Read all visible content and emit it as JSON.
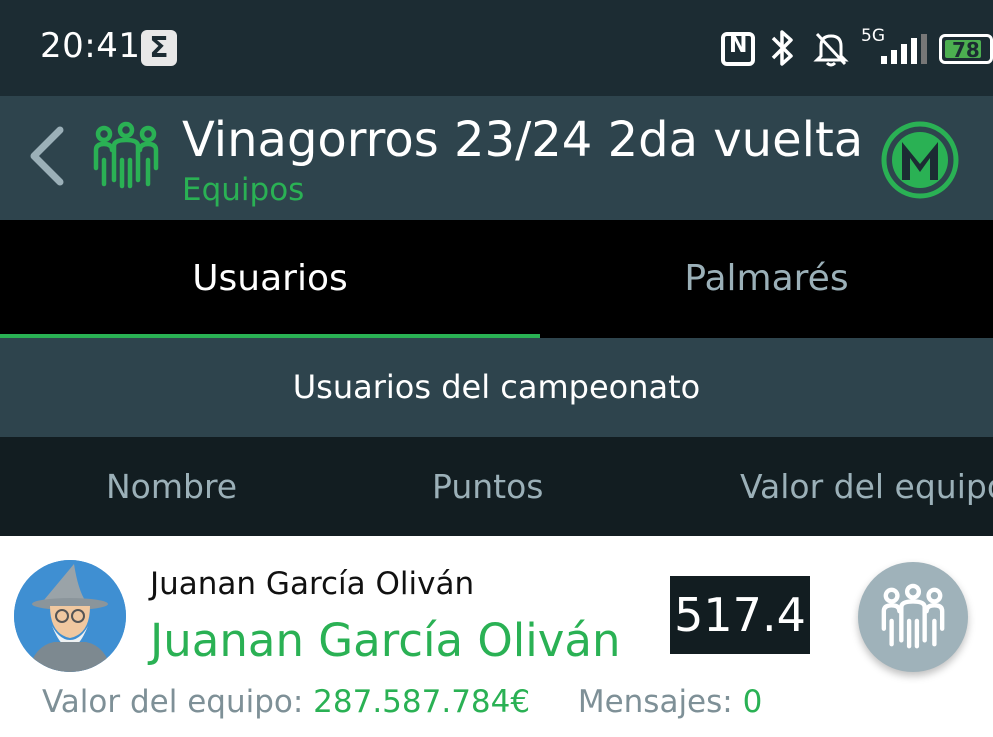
{
  "status_bar": {
    "time": "20:41",
    "notification_icon": "sigma-icon",
    "network_label": "5G",
    "battery_level": "78",
    "battery_color": "#4caf50",
    "icons": [
      "nfc-icon",
      "bluetooth-icon",
      "bell-off-icon",
      "signal-icon",
      "battery-icon"
    ]
  },
  "app_bar": {
    "title": "Vinagorros 23/24 2da vuelta",
    "subtitle": "Equipos",
    "back_icon": "chevron-left-icon",
    "teams_icon": "team-icon",
    "logo_icon": "league-logo"
  },
  "tabs": [
    {
      "label": "Usuarios",
      "active": true
    },
    {
      "label": "Palmarés",
      "active": false
    }
  ],
  "section": {
    "title": "Usuarios del campeonato"
  },
  "columns": {
    "name": "Nombre",
    "points": "Puntos",
    "value": "Valor del equipo"
  },
  "users": [
    {
      "name_small": "Juanan García Oliván",
      "name_big": "Juanan García Oliván",
      "points": "517.4",
      "team_value_label": "Valor del equipo:",
      "team_value": "287.587.784€",
      "messages_label": "Mensajes:",
      "messages": "0"
    }
  ],
  "colors": {
    "accent": "#2ab154",
    "status_bg": "#1c2c33",
    "header_bg": "#2e444d",
    "column_header_bg": "#121d21",
    "muted_text": "#9bb0b8"
  }
}
